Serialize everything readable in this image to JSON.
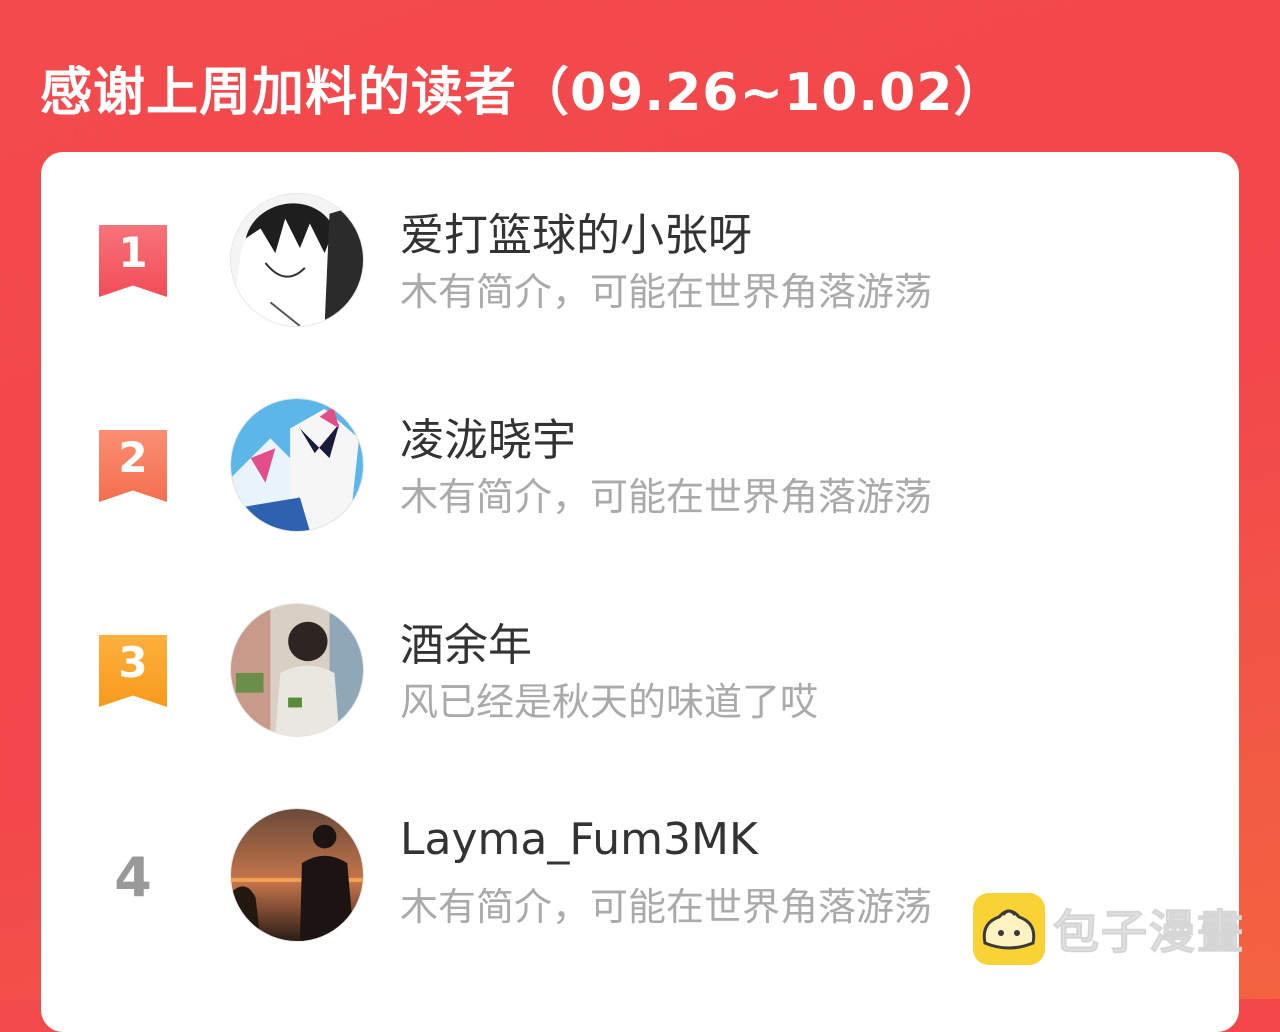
{
  "header": {
    "title": "感谢上周加料的读者（09.26~10.02）"
  },
  "readers": [
    {
      "rank": "1",
      "name": "爱打篮球的小张呀",
      "desc": "木有简介，可能在世界角落游荡"
    },
    {
      "rank": "2",
      "name": "凌泷晓宇",
      "desc": "木有简介，可能在世界角落游荡"
    },
    {
      "rank": "3",
      "name": "酒余年",
      "desc": "风已经是秋天的味道了哎"
    },
    {
      "rank": "4",
      "name": "Layma_Fum3MK",
      "desc": "木有简介，可能在世界角落游荡"
    }
  ],
  "watermark": {
    "text": "包子漫畫",
    "icon": "bun-icon"
  },
  "colors": {
    "background": "#f34a4d",
    "rank1": "#f24d57",
    "rank2": "#f36f4f",
    "rank3": "#f79a1c",
    "rank_plain": "#999999",
    "name_text": "#333333",
    "desc_text": "#aaaaaa",
    "watermark_logo": "#f9d234"
  }
}
